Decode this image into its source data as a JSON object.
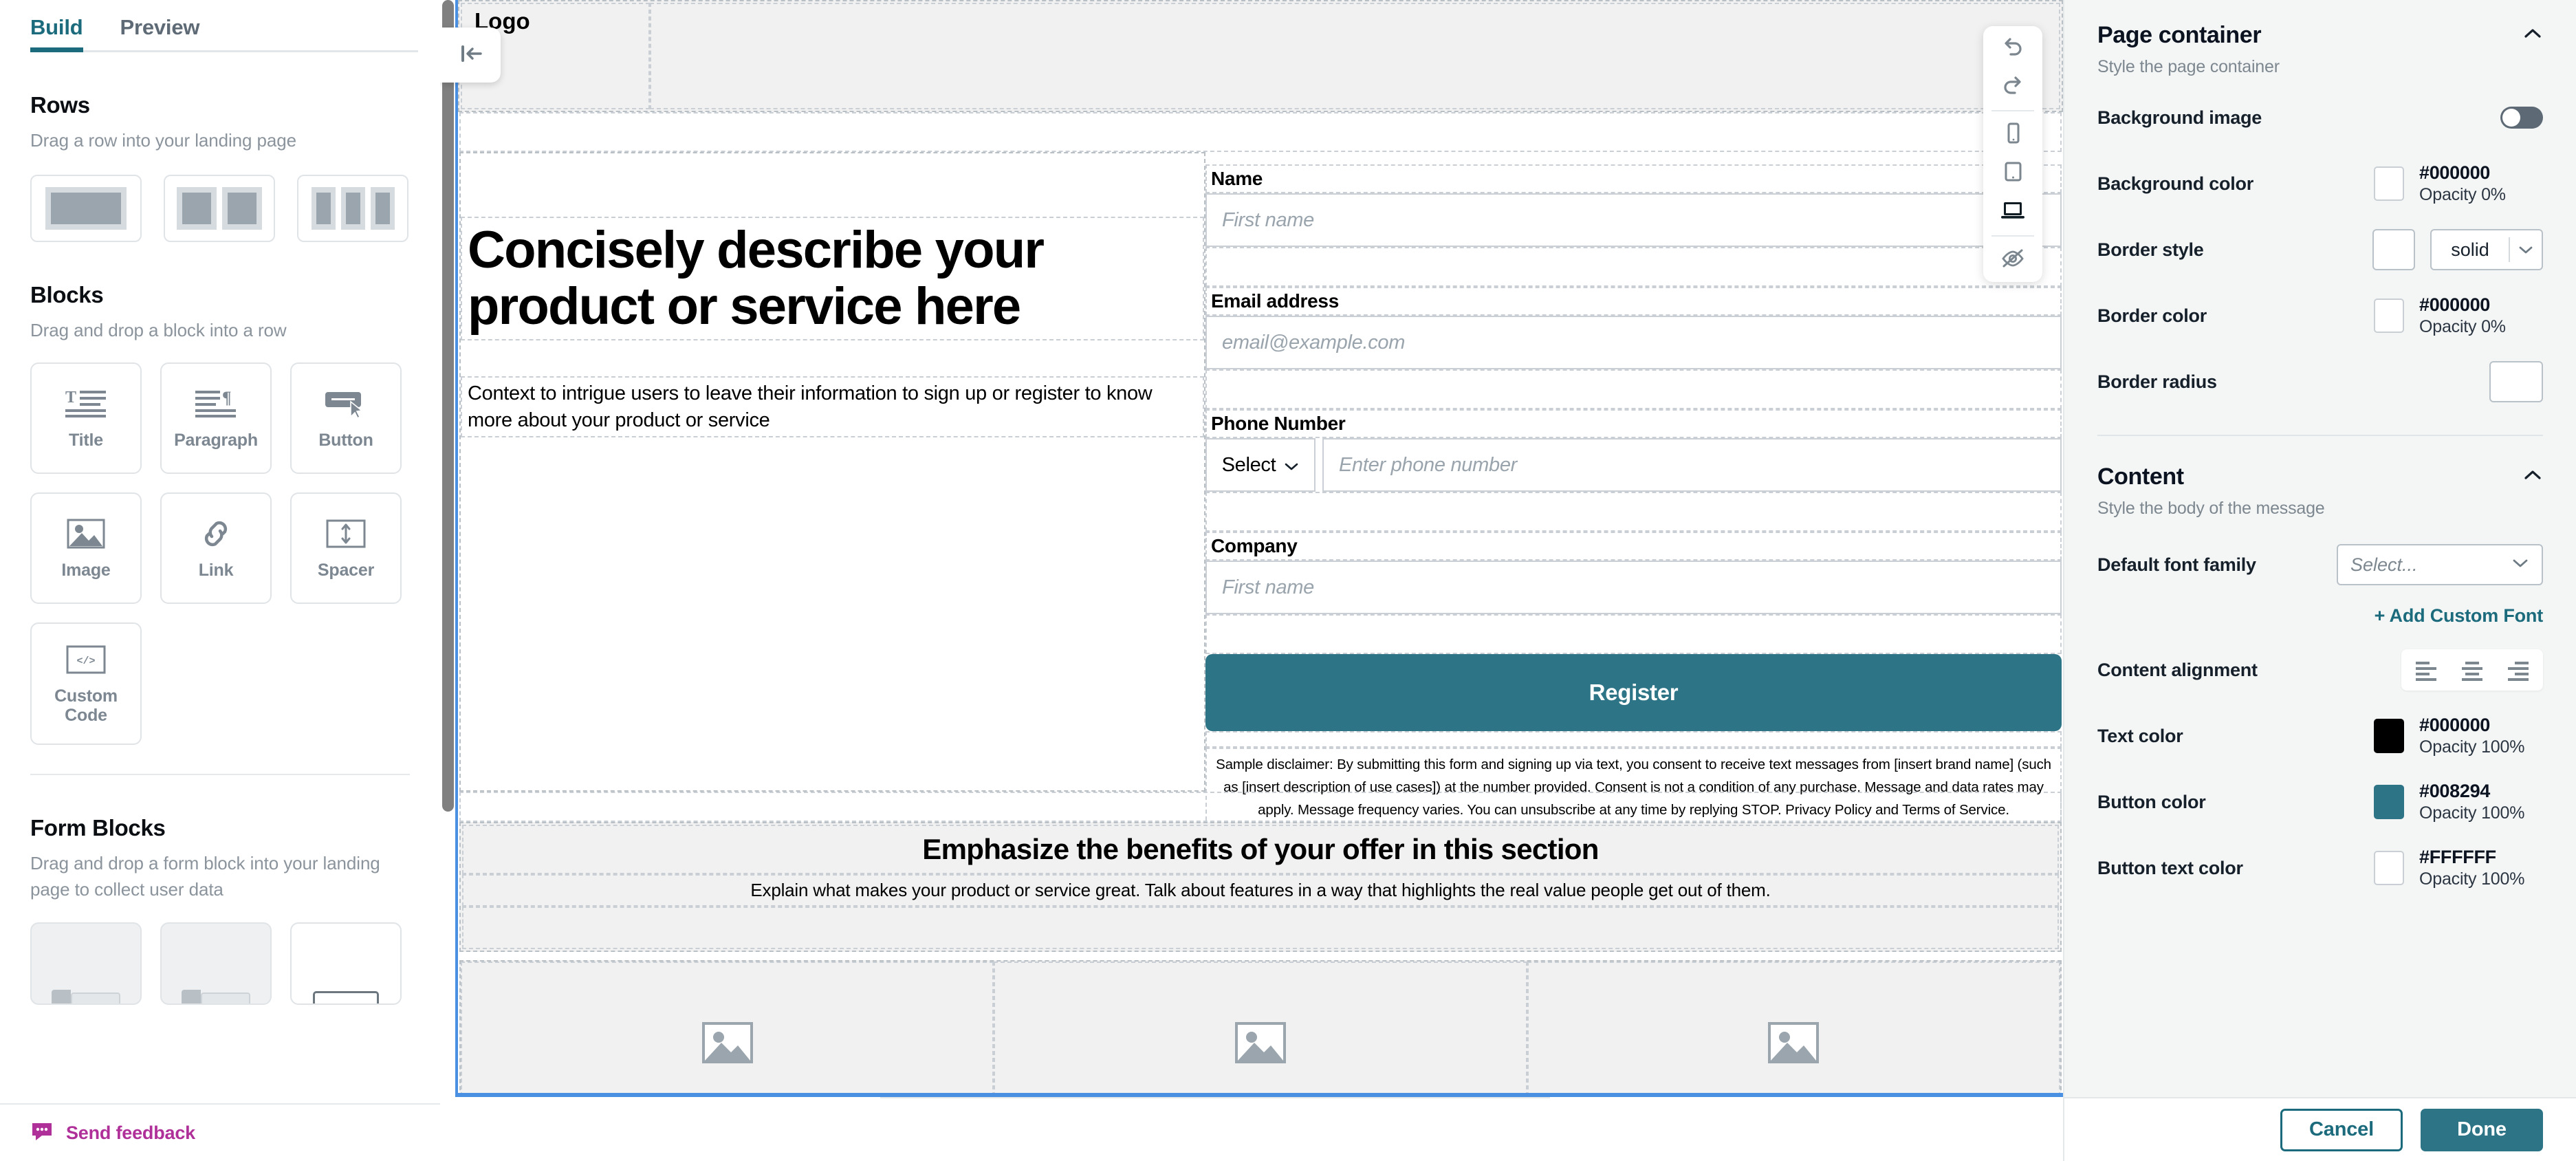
{
  "sidebar": {
    "tabs": [
      {
        "label": "Build",
        "active": true
      },
      {
        "label": "Preview",
        "active": false
      }
    ],
    "rows": {
      "title": "Rows",
      "subtitle": "Drag a row into your landing page",
      "options": [
        "one-column",
        "two-column",
        "three-column"
      ]
    },
    "blocks": {
      "title": "Blocks",
      "subtitle": "Drag and drop a block into a row",
      "items": [
        {
          "label": "Title",
          "icon": "title-icon"
        },
        {
          "label": "Paragraph",
          "icon": "paragraph-icon"
        },
        {
          "label": "Button",
          "icon": "button-icon"
        },
        {
          "label": "Image",
          "icon": "image-icon"
        },
        {
          "label": "Link",
          "icon": "link-icon"
        },
        {
          "label": "Spacer",
          "icon": "spacer-icon"
        },
        {
          "label": "Custom Code",
          "icon": "code-icon"
        }
      ]
    },
    "form_blocks": {
      "title": "Form Blocks",
      "subtitle": "Drag and drop a form block into your landing page to collect user data"
    },
    "feedback": {
      "label": "Send feedback",
      "icon": "chat-bubble-icon",
      "color": "#b0309a"
    }
  },
  "canvas": {
    "collapse_icon": "collapse-left-icon",
    "toolbar": [
      {
        "name": "undo",
        "icon": "undo-icon",
        "active": false
      },
      {
        "name": "redo",
        "icon": "redo-icon",
        "active": false
      },
      {
        "name": "mobile",
        "icon": "mobile-icon",
        "active": false
      },
      {
        "name": "tablet",
        "icon": "tablet-icon",
        "active": false
      },
      {
        "name": "desktop",
        "icon": "desktop-icon",
        "active": true
      },
      {
        "name": "hide-preview",
        "icon": "eye-off-icon",
        "active": false
      }
    ],
    "header": {
      "logo": "Logo"
    },
    "hero": {
      "heading": "Concisely describe your product or service here",
      "paragraph": "Context to intrigue users to leave their information to sign up or register to know more about your product or service"
    },
    "form": {
      "fields": [
        {
          "label": "Name",
          "placeholder": "First name",
          "type": "text"
        },
        {
          "label": "Email address",
          "placeholder": "email@example.com",
          "type": "email"
        },
        {
          "label": "Phone Number",
          "placeholder": "Enter phone number",
          "type": "phone",
          "select_label": "Select"
        },
        {
          "label": "Company",
          "placeholder": "First name",
          "type": "text"
        }
      ],
      "submit_label": "Register",
      "submit_color": "#2c7486",
      "disclaimer": "Sample disclaimer: By submitting this form and signing up via text, you consent to receive text messages from [insert brand name] (such as [insert description of use cases]) at the number provided. Consent is not a condition of any purchase. Message and data rates may apply. Message frequency varies. You can unsubscribe at any time by replying STOP. Privacy Policy and Terms of Service."
    },
    "benefits": {
      "heading": "Emphasize the benefits of your offer in this section",
      "paragraph": "Explain what makes your product or service great. Talk about features in a way that highlights the real value people get out of them.",
      "image_count": 3
    }
  },
  "right_panel": {
    "page_container": {
      "title": "Page container",
      "subtitle": "Style the page container",
      "collapse_icon": "chevron-up-icon",
      "background_image": {
        "label": "Background image",
        "enabled": false
      },
      "background_color": {
        "label": "Background color",
        "hex": "#000000",
        "opacity": "Opacity 0%"
      },
      "border_style": {
        "label": "Border style",
        "value": "solid"
      },
      "border_color": {
        "label": "Border color",
        "hex": "#000000",
        "opacity": "Opacity 0%"
      },
      "border_radius": {
        "label": "Border radius",
        "value": ""
      }
    },
    "content": {
      "title": "Content",
      "subtitle": "Style the body of the message",
      "collapse_icon": "chevron-up-icon",
      "default_font_family": {
        "label": "Default font family",
        "placeholder": "Select..."
      },
      "add_custom_font": "+ Add Custom Font",
      "content_alignment": {
        "label": "Content alignment",
        "options": [
          "align-left",
          "align-center",
          "align-right"
        ]
      },
      "text_color": {
        "label": "Text color",
        "hex": "#000000",
        "opacity": "Opacity 100%",
        "swatch": "#000000"
      },
      "button_color": {
        "label": "Button color",
        "hex": "#008294",
        "opacity": "Opacity 100%",
        "swatch": "#2c7486"
      },
      "button_text_color": {
        "label": "Button text color",
        "hex": "#FFFFFF",
        "opacity": "Opacity 100%",
        "swatch": "#FFFFFF"
      }
    },
    "actions": {
      "cancel": "Cancel",
      "done": "Done"
    }
  }
}
